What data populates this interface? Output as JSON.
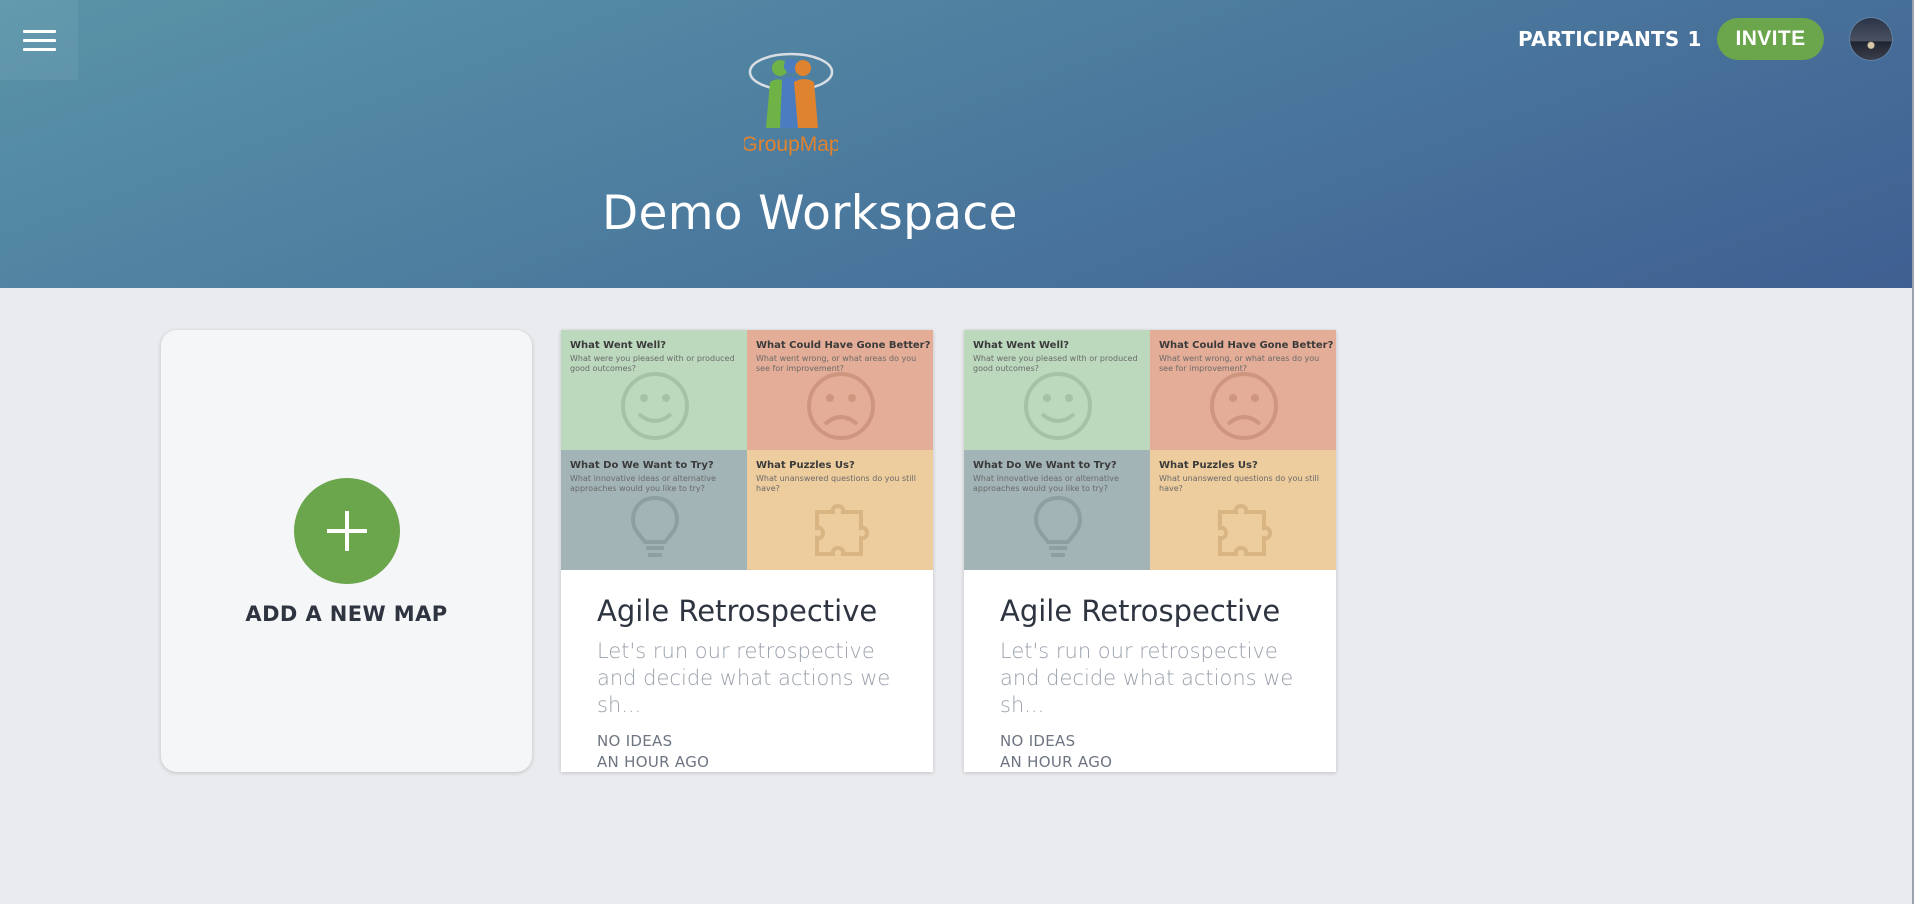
{
  "header": {
    "participants_label": "PARTICIPANTS",
    "participants_count": "1",
    "invite_label": "INVITE",
    "logo_text": "GroupMap",
    "workspace_title": "Demo Workspace"
  },
  "add_card": {
    "label": "ADD A NEW MAP"
  },
  "maps": [
    {
      "title": "Agile Retrospective",
      "description": "Let's run our retrospective and decide what actions we sh...",
      "ideas": "NO IDEAS",
      "time": "AN HOUR AGO",
      "quadrants": [
        {
          "title": "What Went Well?",
          "desc": "What were you pleased with or produced good outcomes?"
        },
        {
          "title": "What Could Have Gone Better?",
          "desc": "What went wrong, or what areas do you see for improvement?"
        },
        {
          "title": "What Do We Want to Try?",
          "desc": "What innovative ideas or alternative approaches would you like to try?"
        },
        {
          "title": "What Puzzles Us?",
          "desc": "What unanswered questions do you still have?"
        }
      ]
    },
    {
      "title": "Agile Retrospective",
      "description": "Let's run our retrospective and decide what actions we sh...",
      "ideas": "NO IDEAS",
      "time": "AN HOUR AGO",
      "quadrants": [
        {
          "title": "What Went Well?",
          "desc": "What were you pleased with or produced good outcomes?"
        },
        {
          "title": "What Could Have Gone Better?",
          "desc": "What went wrong, or what areas do you see for improvement?"
        },
        {
          "title": "What Do We Want to Try?",
          "desc": "What innovative ideas or alternative approaches would you like to try?"
        },
        {
          "title": "What Puzzles Us?",
          "desc": "What unanswered questions do you still have?"
        }
      ]
    }
  ],
  "icons": {
    "menu": "hamburger-menu-icon",
    "add": "plus-icon",
    "went_well": "smiley-face-icon",
    "gone_better": "sad-face-icon",
    "want_to_try": "lightbulb-icon",
    "puzzles": "puzzle-piece-icon"
  },
  "colors": {
    "accent_green": "#6ba54c",
    "header_start": "#5a94a8",
    "header_end": "#3f5f92",
    "quadrant_went_well": "#bcd9be",
    "quadrant_gone_better": "#e4ad97",
    "quadrant_want_to_try": "#a2b4b6",
    "quadrant_puzzles": "#edcc9d"
  }
}
